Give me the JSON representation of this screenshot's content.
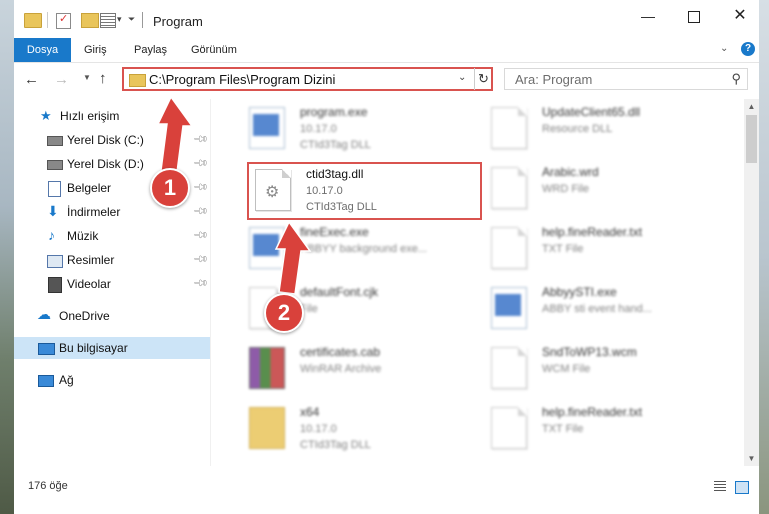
{
  "window": {
    "title": "Program",
    "tabs": [
      "Dosya",
      "Giriş",
      "Paylaş",
      "Görünüm"
    ],
    "help": "?"
  },
  "nav": {
    "address": "C:\\Program Files\\Program Dizini",
    "search_placeholder": "Ara: Program"
  },
  "sidebar": {
    "items": [
      {
        "label": "Hızlı erişim",
        "icon": "star-icon"
      },
      {
        "label": "Yerel Disk (C:)",
        "icon": "drive-icon",
        "pinned": true
      },
      {
        "label": "Yerel Disk (D:)",
        "icon": "drive-icon",
        "pinned": true
      },
      {
        "label": "Belgeler",
        "icon": "documents-icon",
        "pinned": true
      },
      {
        "label": "İndirmeler",
        "icon": "download-icon",
        "pinned": true
      },
      {
        "label": "Müzik",
        "icon": "music-icon",
        "pinned": true
      },
      {
        "label": "Resimler",
        "icon": "pictures-icon",
        "pinned": true
      },
      {
        "label": "Videolar",
        "icon": "videos-icon",
        "pinned": true
      },
      {
        "label": "OneDrive",
        "icon": "cloud-icon"
      },
      {
        "label": "Bu bilgisayar",
        "icon": "computer-icon",
        "selected": true
      },
      {
        "label": "Ağ",
        "icon": "network-icon"
      }
    ]
  },
  "files": {
    "left": [
      {
        "name": "program.exe",
        "line2": "10.17.0",
        "line3": "CTId3Tag DLL"
      },
      {
        "name": "ctid3tag.dll",
        "line2": "10.17.0",
        "line3": "CTId3Tag DLL"
      },
      {
        "name": "fineExec.exe",
        "line2": "ABBYY background exe..."
      },
      {
        "name": "defaultFont.cjk",
        "line2": "File"
      },
      {
        "name": "certificates.cab",
        "line2": "WinRAR Archive"
      },
      {
        "name": "x64",
        "line2": "10.17.0",
        "line3": "CTId3Tag DLL"
      }
    ],
    "right": [
      {
        "name": "UpdateClient65.dll",
        "line2": "Resource DLL"
      },
      {
        "name": "Arabic.wrd",
        "line2": "WRD File"
      },
      {
        "name": "help.fineReader.txt",
        "line2": "TXT File"
      },
      {
        "name": "AbbyySTI.exe",
        "line2": "ABBY sti event hand..."
      },
      {
        "name": "SndToWP13.wcm",
        "line2": "WCM File"
      },
      {
        "name": "help.fineReader.txt",
        "line2": "TXT File"
      }
    ]
  },
  "status": {
    "count": "176 öğe"
  },
  "annotations": {
    "step1": "1",
    "step2": "2",
    "color": "#d9413b"
  }
}
